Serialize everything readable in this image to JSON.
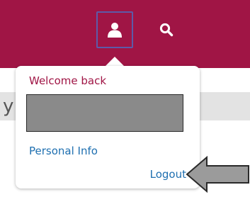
{
  "header": {
    "background_color": "#a01545",
    "user_icon": "user-icon",
    "search_icon": "search-icon"
  },
  "banner": {
    "partial_text": "y"
  },
  "user_menu": {
    "welcome_text": "Welcome back",
    "username": "",
    "links": {
      "personal_info": "Personal Info",
      "logout": "Logout"
    }
  },
  "annotation": {
    "arrow_icon": "left-arrow-icon",
    "color": "#9b9b9b"
  }
}
